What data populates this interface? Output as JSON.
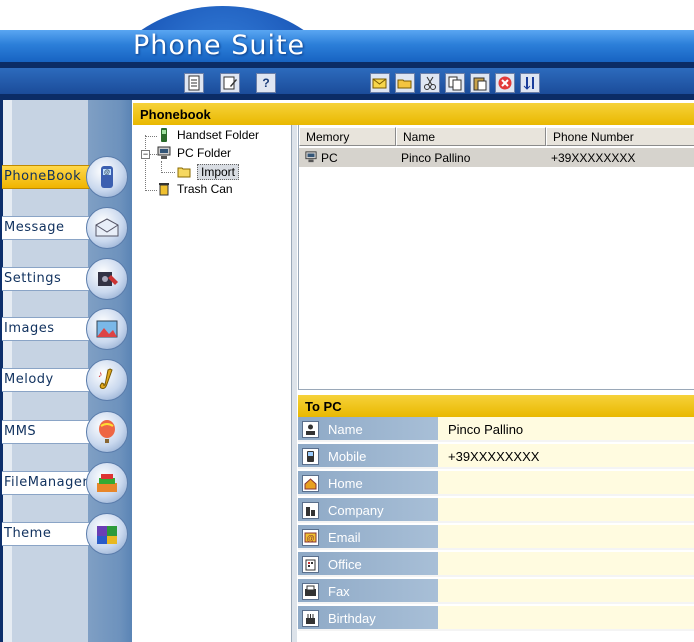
{
  "app": {
    "title": "Phone Suite"
  },
  "toolbar_left": [
    {
      "icon": "new-document-icon"
    },
    {
      "icon": "edit-document-icon"
    },
    {
      "icon": "help-icon",
      "glyph": "?"
    }
  ],
  "toolbar_right": [
    {
      "icon": "new-mail-icon"
    },
    {
      "icon": "open-folder-icon"
    },
    {
      "icon": "cut-icon"
    },
    {
      "icon": "copy-icon"
    },
    {
      "icon": "paste-icon"
    },
    {
      "icon": "delete-icon"
    },
    {
      "icon": "sort-icon"
    }
  ],
  "nav": [
    {
      "label": "PhoneBook",
      "icon": "phone-icon",
      "active": true
    },
    {
      "label": "Message",
      "icon": "envelope-icon"
    },
    {
      "label": "Settings",
      "icon": "settings-tools-icon"
    },
    {
      "label": "Images",
      "icon": "images-icon"
    },
    {
      "label": "Melody",
      "icon": "saxophone-icon"
    },
    {
      "label": "MMS",
      "icon": "balloon-icon"
    },
    {
      "label": "FileManager",
      "icon": "folder-stack-icon"
    },
    {
      "label": "Theme",
      "icon": "theme-blocks-icon"
    }
  ],
  "phonebook": {
    "header": "Phonebook",
    "tree": [
      {
        "label": "Handset Folder",
        "icon": "handset-icon"
      },
      {
        "label": "PC Folder",
        "icon": "pc-icon",
        "expanded": true
      },
      {
        "label": "Import",
        "icon": "folder-icon",
        "selected": true
      },
      {
        "label": "Trash Can",
        "icon": "trash-icon"
      }
    ],
    "columns": [
      "Memory",
      "Name",
      "Phone Number"
    ],
    "rows": [
      {
        "memory": "PC",
        "name": "Pinco Pallino",
        "phone": "+39XXXXXXXX"
      }
    ]
  },
  "to_pc": {
    "header": "To PC",
    "fields": [
      {
        "label": "Name",
        "value": "Pinco Pallino",
        "icon": "contact-icon"
      },
      {
        "label": "Mobile",
        "value": "+39XXXXXXXX",
        "icon": "mobile-icon"
      },
      {
        "label": "Home",
        "value": "",
        "icon": "home-icon"
      },
      {
        "label": "Company",
        "value": "",
        "icon": "company-icon"
      },
      {
        "label": "Email",
        "value": "",
        "icon": "email-icon"
      },
      {
        "label": "Office",
        "value": "",
        "icon": "office-icon"
      },
      {
        "label": "Fax",
        "value": "",
        "icon": "fax-icon"
      },
      {
        "label": "Birthday",
        "value": "",
        "icon": "birthday-icon"
      }
    ]
  },
  "colors": {
    "accent": "#f0c000",
    "title_blue": "#2c7fd9",
    "field_bg": "#fffbe0"
  }
}
